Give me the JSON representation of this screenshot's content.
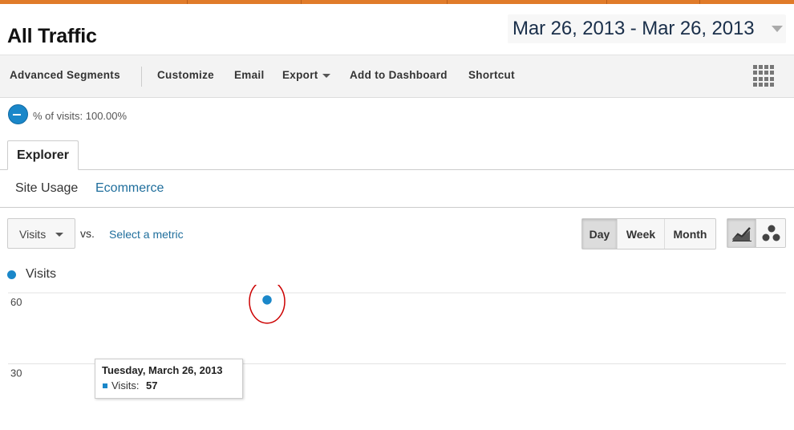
{
  "header": {
    "title": "All Traffic",
    "date_range": "Mar 26, 2013 - Mar 26, 2013"
  },
  "toolbar": {
    "items": [
      "Advanced Segments",
      "Customize",
      "Email",
      "Export",
      "Add to Dashboard",
      "Shortcut"
    ]
  },
  "segment": {
    "text": "% of visits: 100.00%"
  },
  "tabs": {
    "explorer": "Explorer",
    "subtabs": [
      "Site Usage",
      "Ecommerce"
    ]
  },
  "controls": {
    "metric": "Visits",
    "vs": "vs.",
    "select_metric": "Select a metric",
    "periods": [
      "Day",
      "Week",
      "Month"
    ],
    "active_period": "Day",
    "chart_types": [
      "line-chart-icon",
      "motion-chart-icon"
    ]
  },
  "legend": {
    "series": "Visits"
  },
  "tooltip": {
    "title": "Tuesday, March 26, 2013",
    "label": "Visits:",
    "value": "57"
  },
  "colors": {
    "accent": "#e07b2a",
    "series": "#1a87c9",
    "link": "#1f6e9c",
    "annotation": "#cc0000"
  },
  "chart_data": {
    "type": "line",
    "x": [
      "Tuesday, March 26, 2013"
    ],
    "series": [
      {
        "name": "Visits",
        "values": [
          57
        ]
      }
    ],
    "yticks": [
      30,
      60
    ],
    "ylim": [
      0,
      66
    ],
    "grid": true
  }
}
